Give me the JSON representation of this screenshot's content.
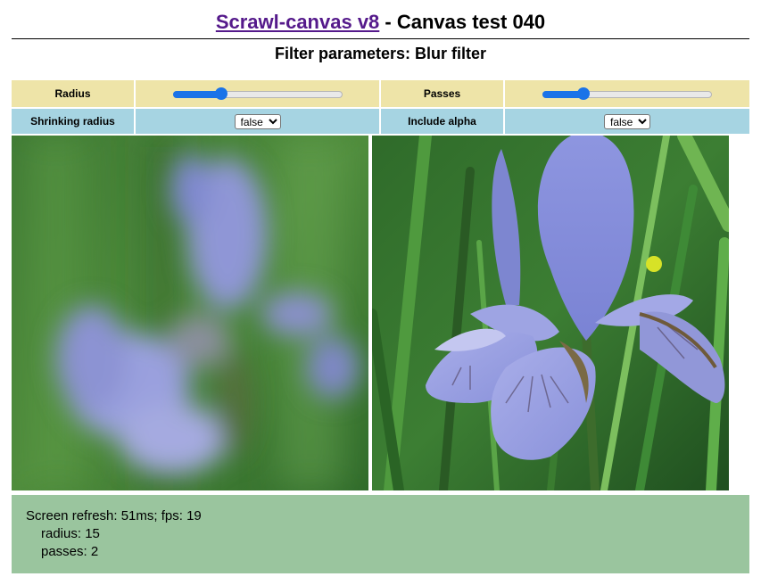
{
  "header": {
    "link_text": "Scrawl-canvas v8",
    "title_suffix": " - Canvas test 040",
    "subtitle": "Filter parameters: Blur filter"
  },
  "controls": {
    "radius": {
      "label": "Radius",
      "value_fraction": 0.27
    },
    "passes": {
      "label": "Passes",
      "value_fraction": 0.22
    },
    "shrinking_radius": {
      "label": "Shrinking radius",
      "selected": "false"
    },
    "include_alpha": {
      "label": "Include alpha",
      "selected": "false"
    }
  },
  "report": {
    "refresh": "Screen refresh: 51ms; fps: 19",
    "radius": "radius: 15",
    "passes": "passes: 2"
  },
  "colors": {
    "row_yellow": "#eee4a8",
    "row_blue": "#a6d4e2",
    "report_green": "#9ac59e",
    "link_purple": "#551a8b",
    "slider_accent": "#1a73e8"
  },
  "images": {
    "left": "blurred-iris-flower",
    "right": "iris-flower"
  }
}
